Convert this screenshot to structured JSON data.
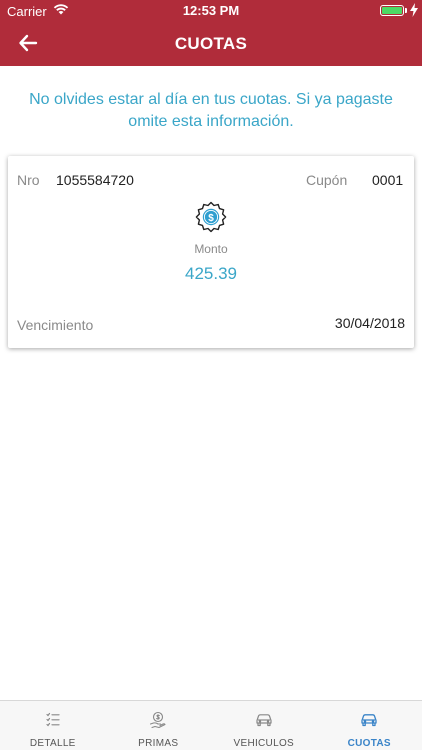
{
  "status_bar": {
    "carrier": "Carrier",
    "time": "12:53 PM"
  },
  "header": {
    "title": "CUOTAS",
    "background_color": "#b02c3a"
  },
  "notice": {
    "text": "No olvides estar al día en tus cuotas. Si ya pagaste omite esta información.",
    "color": "#3aa6c8"
  },
  "card": {
    "nro_label": "Nro",
    "nro_value": "1055584720",
    "cupon_label": "Cupón",
    "cupon_value": "0001",
    "monto_icon": "money-badge-icon",
    "monto_label": "Monto",
    "monto_value": "425.39",
    "vencimiento_label": "Vencimiento",
    "vencimiento_value": "30/04/2018"
  },
  "tabs": [
    {
      "label": "DETALLE",
      "icon": "list-icon",
      "active": false
    },
    {
      "label": "PRIMAS",
      "icon": "hand-coin-icon",
      "active": false
    },
    {
      "label": "VEHICULOS",
      "icon": "car-icon",
      "active": false
    },
    {
      "label": "CUOTAS",
      "icon": "car-active-icon",
      "active": true
    }
  ],
  "colors": {
    "accent": "#3aa6c8",
    "active_tab": "#3a84c8"
  }
}
